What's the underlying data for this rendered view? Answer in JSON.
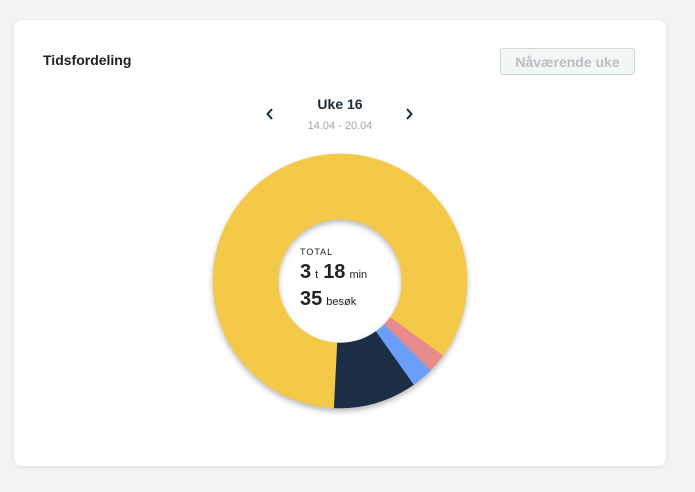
{
  "card": {
    "title": "Tidsfordeling",
    "current_week_button": "Nåværende uke"
  },
  "week": {
    "label": "Uke 16",
    "range": "14.04 - 20.04",
    "prev_icon": "chevron-left-icon",
    "next_icon": "chevron-right-icon"
  },
  "totals": {
    "label": "TOTAL",
    "hours": "3",
    "hours_unit": "t",
    "minutes": "18",
    "minutes_unit": "min",
    "visits": "35",
    "visits_unit": "besøk"
  },
  "chart_data": {
    "type": "pie",
    "donut": true,
    "slices": [
      {
        "value": 0.1,
        "color": "#f4c948"
      },
      {
        "value": 0.024,
        "color": "#e98b8b"
      },
      {
        "value": 0.028,
        "color": "#6a9ef8"
      },
      {
        "value": 0.106,
        "color": "#1b2e46"
      },
      {
        "value": 0.742,
        "color": "#f4c948"
      }
    ]
  }
}
